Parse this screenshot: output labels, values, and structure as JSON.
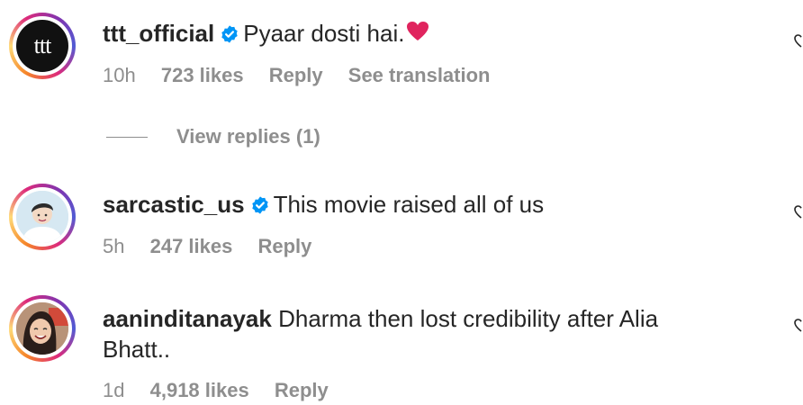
{
  "comments": [
    {
      "username": "ttt_official",
      "verified": true,
      "text": "Pyaar dosti hai.",
      "emoji": "❤️",
      "time": "10h",
      "likes": "723 likes",
      "reply": "Reply",
      "translation": "See translation",
      "avatar_text": "ttt",
      "avatar_icon": "ttt-logo-avatar"
    },
    {
      "username": "sarcastic_us",
      "verified": true,
      "text": "This movie raised all of us",
      "time": "5h",
      "likes": "247 likes",
      "reply": "Reply",
      "avatar_icon": "cartoon-boy-avatar"
    },
    {
      "username": "aaninditanayak",
      "verified": false,
      "text_line1": "Dharma then lost credibility after Alia",
      "text_line2": "Bhatt..",
      "time": "1d",
      "likes": "4,918 likes",
      "reply": "Reply",
      "avatar_icon": "smiling-girl-avatar"
    }
  ],
  "view_replies": "View replies (1)",
  "colors": {
    "text": "#262626",
    "secondary": "#8e8e8e",
    "verified_blue": "#0095f6",
    "heart_red": "#ed4956"
  }
}
